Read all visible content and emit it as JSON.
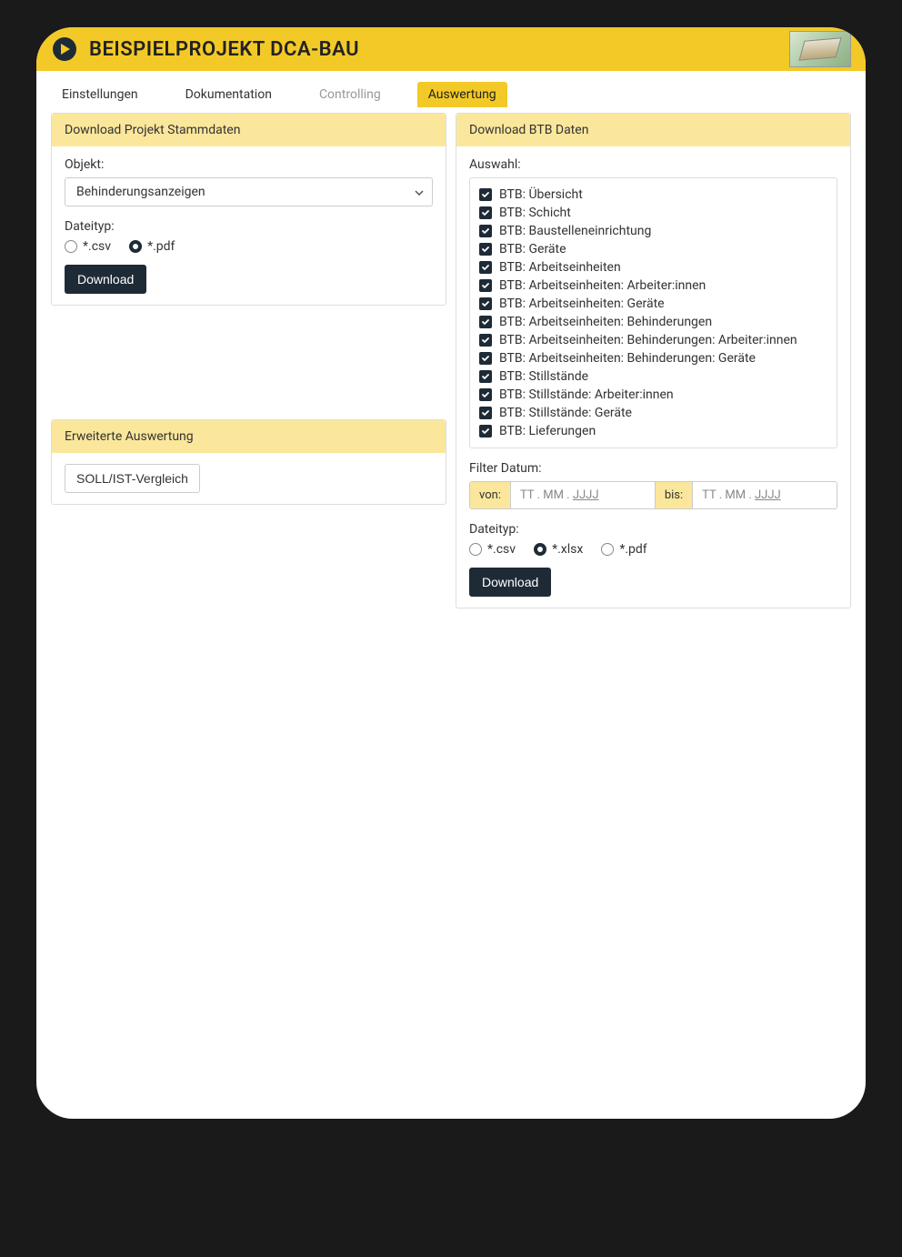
{
  "header": {
    "title": "BEISPIELPROJEKT DCA-BAU"
  },
  "tabs": [
    {
      "label": "Einstellungen",
      "active": false,
      "disabled": false
    },
    {
      "label": "Dokumentation",
      "active": false,
      "disabled": false
    },
    {
      "label": "Controlling",
      "active": false,
      "disabled": true
    },
    {
      "label": "Auswertung",
      "active": true,
      "disabled": false
    }
  ],
  "panel_stammdaten": {
    "title": "Download Projekt Stammdaten",
    "objekt_label": "Objekt:",
    "objekt_value": "Behinderungsanzeigen",
    "dateityp_label": "Dateityp:",
    "dateityp_options": [
      "*.csv",
      "*.pdf"
    ],
    "dateityp_selected": "*.pdf",
    "download_label": "Download"
  },
  "panel_btb": {
    "title": "Download BTB Daten",
    "auswahl_label": "Auswahl:",
    "items": [
      "BTB: Übersicht",
      "BTB: Schicht",
      "BTB: Baustelleneinrichtung",
      "BTB: Geräte",
      "BTB: Arbeitseinheiten",
      "BTB: Arbeitseinheiten: Arbeiter:innen",
      "BTB: Arbeitseinheiten: Geräte",
      "BTB: Arbeitseinheiten: Behinderungen",
      "BTB: Arbeitseinheiten: Behinderungen: Arbeiter:innen",
      "BTB: Arbeitseinheiten: Behinderungen: Geräte",
      "BTB: Stillstände",
      "BTB: Stillstände: Arbeiter:innen",
      "BTB: Stillstände: Geräte",
      "BTB: Lieferungen"
    ],
    "filter_label": "Filter Datum:",
    "von_label": "von:",
    "bis_label": "bis:",
    "date_placeholder_parts": {
      "tt": "TT",
      "mm": "MM",
      "jjjj": "JJJJ",
      "dot": " . "
    },
    "dateityp_label": "Dateityp:",
    "dateityp_options": [
      "*.csv",
      "*.xlsx",
      "*.pdf"
    ],
    "dateityp_selected": "*.xlsx",
    "download_label": "Download"
  },
  "panel_erweitert": {
    "title": "Erweiterte Auswertung",
    "button_label": "SOLL/IST-Vergleich"
  }
}
